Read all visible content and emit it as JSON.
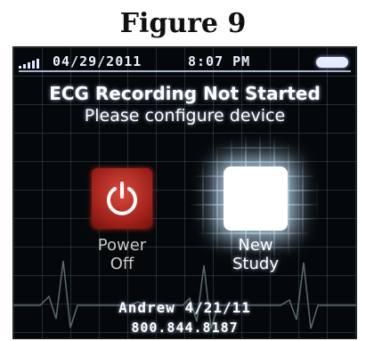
{
  "figure_caption": "Figure 9",
  "status_bar": {
    "date": "04/29/2011",
    "time": "8:07 PM",
    "icons": {
      "signal": "signal-strength-icon",
      "battery": "battery-icon"
    }
  },
  "message": {
    "title": "ECG Recording Not Started",
    "subtitle": "Please configure device"
  },
  "buttons": {
    "power_off": {
      "label_line1": "Power",
      "label_line2": "Off",
      "icon": "power-icon"
    },
    "new_study": {
      "label_line1": "New",
      "label_line2": "Study"
    }
  },
  "footer": {
    "line1": "Andrew 4/21/11",
    "line2": "800.844.8187"
  },
  "colors": {
    "screen_background": "#05080a",
    "power_button": "#b3261e",
    "new_study_button": "#ffffff",
    "text": "#ffffff"
  }
}
